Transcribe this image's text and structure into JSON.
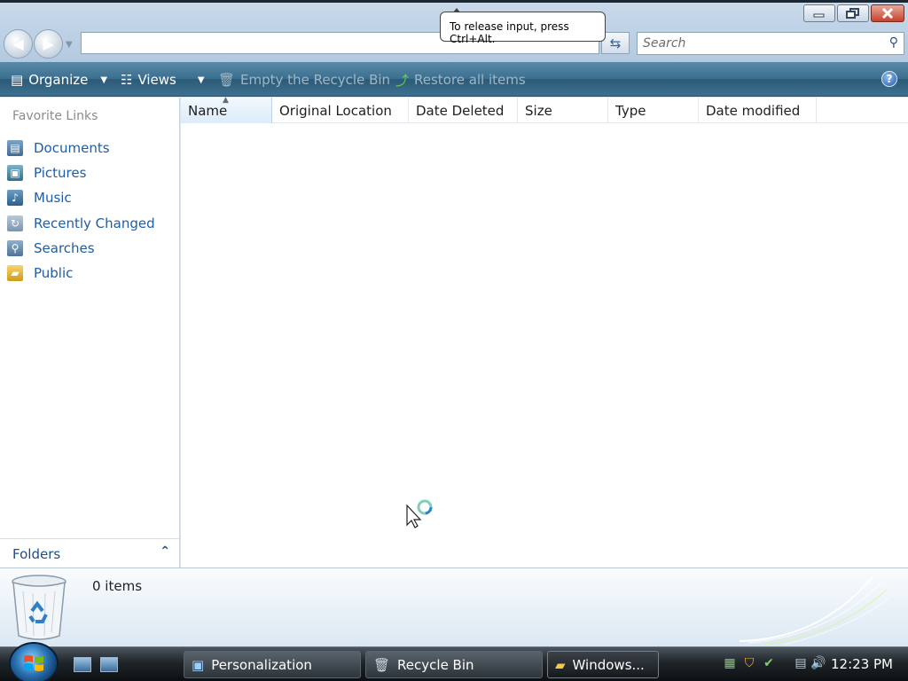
{
  "window": {
    "address_value": "",
    "search_placeholder": "Search",
    "tooltip": "To release input, press Ctrl+Alt."
  },
  "toolbar": {
    "organize": "Organize",
    "views": "Views",
    "empty_bin": "Empty the Recycle Bin",
    "restore_all": "Restore all items"
  },
  "sidebar": {
    "title": "Favorite Links",
    "items": [
      {
        "label": "Documents",
        "icon": "documents-icon"
      },
      {
        "label": "Pictures",
        "icon": "pictures-icon"
      },
      {
        "label": "Music",
        "icon": "music-icon"
      },
      {
        "label": "Recently Changed",
        "icon": "recently-changed-icon"
      },
      {
        "label": "Searches",
        "icon": "searches-icon"
      },
      {
        "label": "Public",
        "icon": "public-folder-icon"
      }
    ],
    "folders_label": "Folders"
  },
  "columns": [
    "Name",
    "Original Location",
    "Date Deleted",
    "Size",
    "Type",
    "Date modified"
  ],
  "details": {
    "items_count": "0 items"
  },
  "taskbar": {
    "buttons": [
      "Personalization",
      "Recycle Bin",
      "Windows..."
    ],
    "clock": "12:23 PM"
  },
  "colors": {
    "accent": "#1f5da5",
    "toolbar": "#3a6e8f",
    "taskbar": "#1f2529"
  }
}
